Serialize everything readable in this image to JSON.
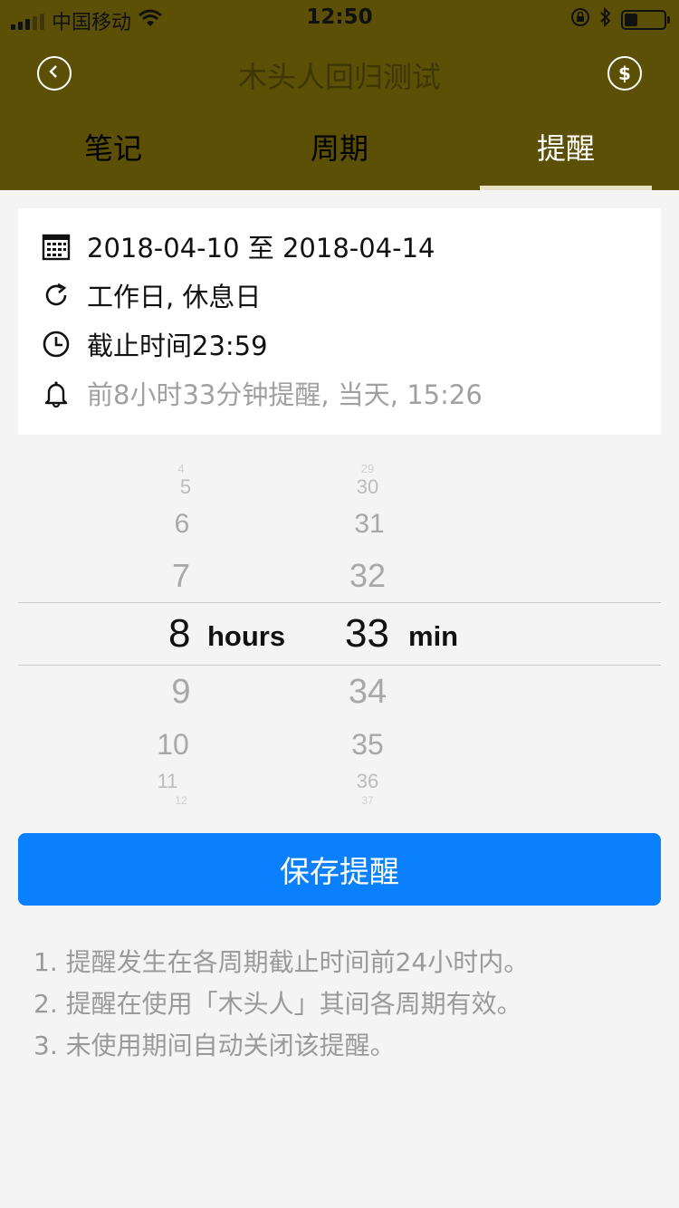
{
  "status_bar": {
    "carrier": "中国移动",
    "time": "12:50"
  },
  "nav": {
    "title": "木头人回归测试",
    "back_icon": "chevron-left-circle-icon",
    "money_icon": "dollar-circle-icon"
  },
  "tabs": [
    {
      "label": "笔记",
      "active": false
    },
    {
      "label": "周期",
      "active": false
    },
    {
      "label": "提醒",
      "active": true
    }
  ],
  "info": {
    "date_range": "2018-04-10 至 2018-04-14",
    "repeat": "工作日, 休息日",
    "deadline": "截止时间23:59",
    "reminder": "前8小时33分钟提醒, 当天, 15:26"
  },
  "picker": {
    "hours_above": [
      "4",
      "5",
      "6",
      "7"
    ],
    "hours_selected": "8",
    "hours_unit": "hours",
    "hours_below": [
      "9",
      "10",
      "11",
      "12"
    ],
    "minutes_above": [
      "29",
      "30",
      "31",
      "32"
    ],
    "minutes_selected": "33",
    "minutes_unit": "min",
    "minutes_below": [
      "34",
      "35",
      "36",
      "37"
    ]
  },
  "save_button": "保存提醒",
  "notes": [
    "1. 提醒发生在各周期截止时间前24小时内。",
    "2. 提醒在使用「木头人」其间各周期有效。",
    "3. 未使用期间自动关闭该提醒。"
  ],
  "colors": {
    "header_bg": "#5c4f06",
    "accent_blue": "#0a80ff"
  }
}
